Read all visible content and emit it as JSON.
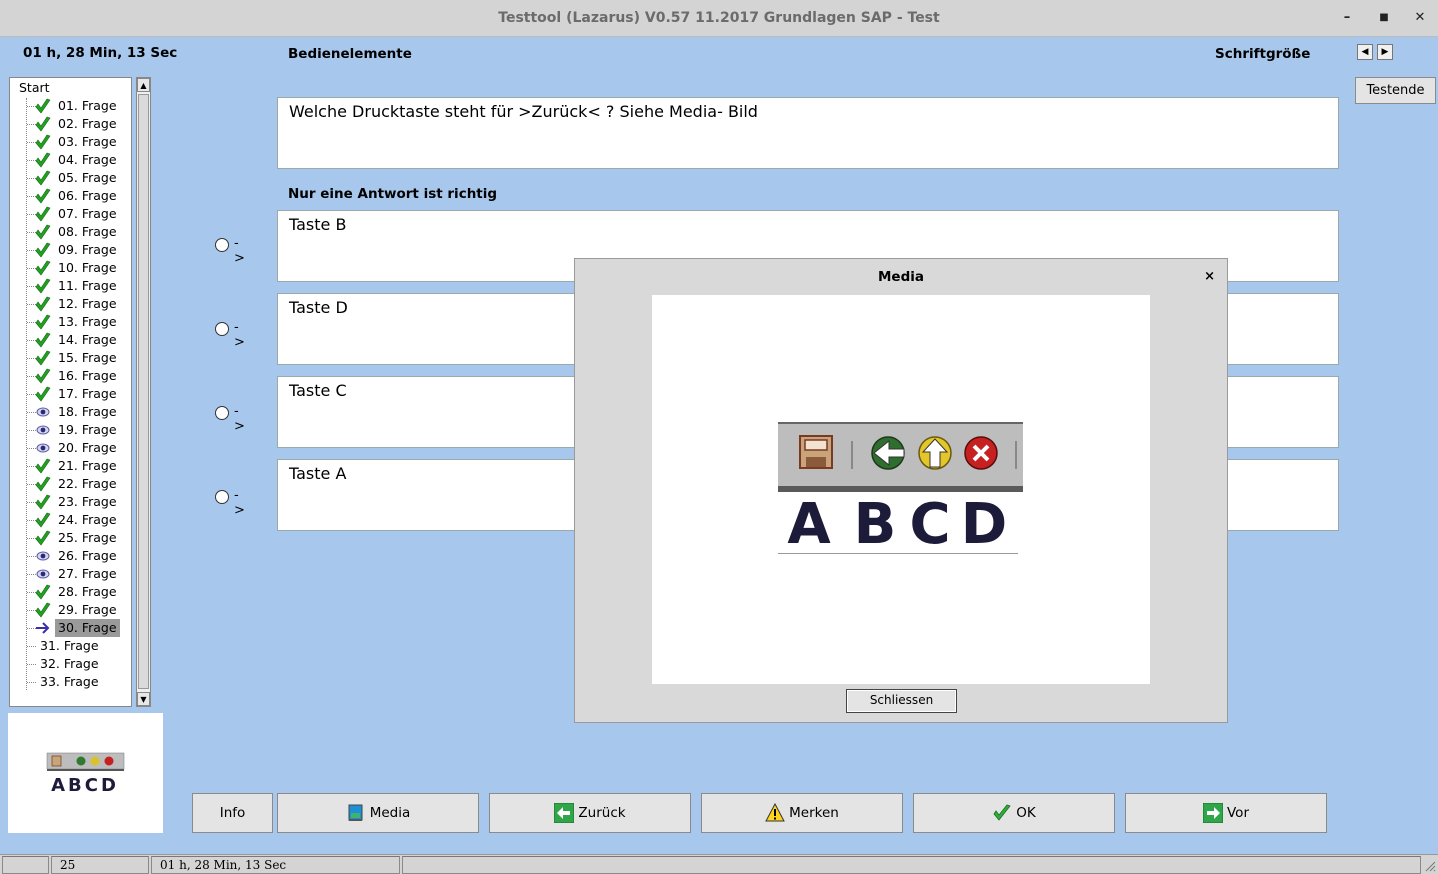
{
  "window": {
    "title": "Testtool (Lazarus) V0.57 11.2017 Grundlagen SAP - Test",
    "minimize_icon": "minimize-icon",
    "maximize_icon": "maximize-icon",
    "close_icon": "close-icon",
    "minimize_glyph": "–",
    "maximize_glyph": "■",
    "close_glyph": "✕"
  },
  "header": {
    "timer": "01 h, 28 Min, 13 Sec",
    "section": "Bedienelemente",
    "fontsize_label": "Schriftgröße",
    "fontsize_left": "◀",
    "fontsize_right": "▶",
    "end_button": "Testende"
  },
  "tree": {
    "root": "Start",
    "items": [
      {
        "label": "01. Frage",
        "state": "done"
      },
      {
        "label": "02. Frage",
        "state": "done"
      },
      {
        "label": "03. Frage",
        "state": "done"
      },
      {
        "label": "04. Frage",
        "state": "done"
      },
      {
        "label": "05. Frage",
        "state": "done"
      },
      {
        "label": "06. Frage",
        "state": "done"
      },
      {
        "label": "07. Frage",
        "state": "done"
      },
      {
        "label": "08. Frage",
        "state": "done"
      },
      {
        "label": "09. Frage",
        "state": "done"
      },
      {
        "label": "10. Frage",
        "state": "done"
      },
      {
        "label": "11. Frage",
        "state": "done"
      },
      {
        "label": "12. Frage",
        "state": "done"
      },
      {
        "label": "13. Frage",
        "state": "done"
      },
      {
        "label": "14. Frage",
        "state": "done"
      },
      {
        "label": "15. Frage",
        "state": "done"
      },
      {
        "label": "16. Frage",
        "state": "done"
      },
      {
        "label": "17. Frage",
        "state": "done"
      },
      {
        "label": "18. Frage",
        "state": "viewed"
      },
      {
        "label": "19. Frage",
        "state": "viewed"
      },
      {
        "label": "20. Frage",
        "state": "viewed"
      },
      {
        "label": "21. Frage",
        "state": "done"
      },
      {
        "label": "22. Frage",
        "state": "done"
      },
      {
        "label": "23. Frage",
        "state": "done"
      },
      {
        "label": "24. Frage",
        "state": "done"
      },
      {
        "label": "25. Frage",
        "state": "done"
      },
      {
        "label": "26. Frage",
        "state": "viewed"
      },
      {
        "label": "27. Frage",
        "state": "viewed"
      },
      {
        "label": "28. Frage",
        "state": "done"
      },
      {
        "label": "29. Frage",
        "state": "done"
      },
      {
        "label": "30. Frage",
        "state": "current"
      },
      {
        "label": "31. Frage",
        "state": "open"
      },
      {
        "label": "32. Frage",
        "state": "open"
      },
      {
        "label": "33. Frage",
        "state": "open"
      }
    ]
  },
  "question": {
    "text": "Welche Drucktaste steht für >Zurück< ? Siehe Media- Bild",
    "hint": "Nur eine Antwort ist richtig",
    "arrow": "->",
    "answers": [
      "Taste B",
      "Taste D",
      "Taste C",
      "Taste A"
    ]
  },
  "buttons": {
    "info": "Info",
    "media": "Media",
    "back": "Zurück",
    "mark": "Merken",
    "ok": "OK",
    "next": "Vor"
  },
  "statusbar": {
    "cell1": "",
    "cell2": "25",
    "cell3": "01 h, 28 Min, 13 Sec",
    "cell4": ""
  },
  "media_dialog": {
    "title": "Media",
    "close_glyph": "×",
    "close_button": "Schliessen",
    "image_letters": [
      "A",
      "B",
      "C",
      "D"
    ]
  },
  "thumbnail": {
    "letters": "ABCD"
  },
  "colors": {
    "background": "#a7c8ec",
    "check_green": "#22a022",
    "current_arrow": "#3a2fa8"
  }
}
